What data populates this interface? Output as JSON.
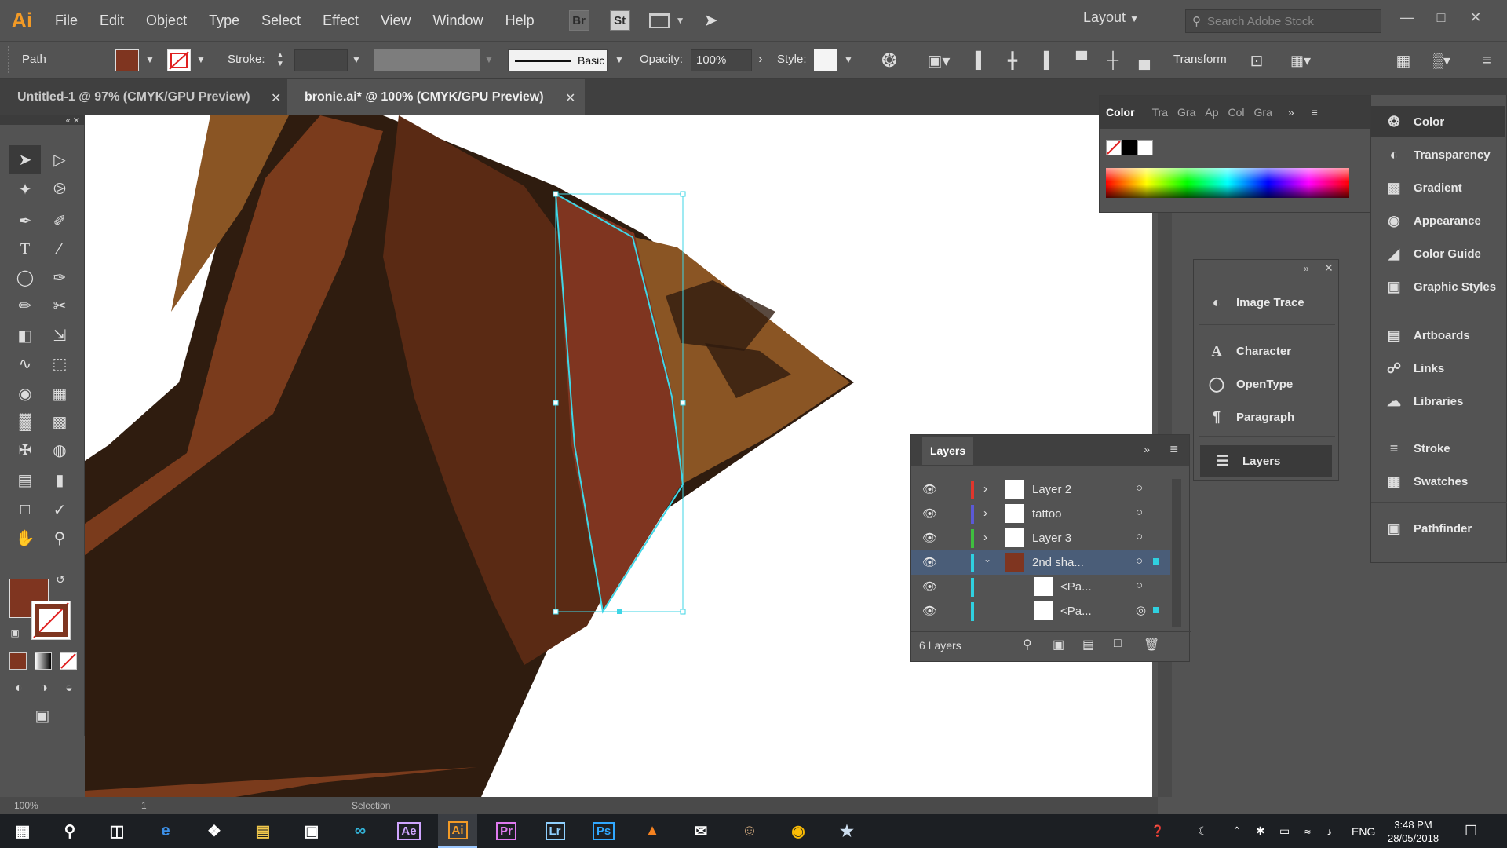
{
  "app": {
    "logo": "Ai"
  },
  "menu": [
    "File",
    "Edit",
    "Object",
    "Type",
    "Select",
    "Effect",
    "View",
    "Window",
    "Help"
  ],
  "bridge_btns": [
    "Br",
    "St"
  ],
  "workspace": "Layout",
  "search": {
    "placeholder": "Search Adobe Stock"
  },
  "control": {
    "selection_label": "Path",
    "stroke_label": "Stroke:",
    "brush_label": "Basic",
    "opacity_label": "Opacity:",
    "opacity_value": "100%",
    "style_label": "Style:",
    "transform_label": "Transform",
    "fill_color": "#7f3520"
  },
  "tabs": [
    {
      "label": "Untitled-1 @ 97% (CMYK/GPU Preview)",
      "active": false
    },
    {
      "label": "bronie.ai* @ 100% (CMYK/GPU Preview)",
      "active": true
    }
  ],
  "color_panel": {
    "tabs": [
      "Color",
      "Tra",
      "Gra",
      "Ap",
      "Col",
      "Gra"
    ]
  },
  "mini_panel": {
    "items": [
      "Image Trace",
      "Character",
      "OpenType",
      "Paragraph",
      "Layers"
    ]
  },
  "layers_panel": {
    "title": "Layers",
    "count": "6 Layers",
    "rows": [
      {
        "name": "Layer 2",
        "color": "#e0362c"
      },
      {
        "name": "tattoo",
        "color": "#5b59d6"
      },
      {
        "name": "Layer 3",
        "color": "#3fbf3f"
      },
      {
        "name": "2nd sha...",
        "color": "#2fd0e0"
      },
      {
        "name": "<Pa...",
        "color": "#2fd0e0"
      },
      {
        "name": "<Pa...",
        "color": "#2fd0e0"
      }
    ]
  },
  "dock": {
    "items": [
      "Color",
      "Transparency",
      "Gradient",
      "Appearance",
      "Color Guide",
      "Graphic Styles",
      "Artboards",
      "Links",
      "Libraries",
      "Stroke",
      "Swatches",
      "Pathfinder"
    ]
  },
  "status": {
    "zoom": "100%",
    "page": "1",
    "tool": "Selection"
  },
  "taskbar": {
    "apps": [
      "Ae",
      "Ai",
      "Pr",
      "Lr",
      "Ps"
    ],
    "lang": "ENG",
    "time": "3:48 PM",
    "date": "28/05/2018"
  },
  "colors": {
    "accent": "#f29a26",
    "selection": "#3fd6e6",
    "brown_dark": "#3d2211",
    "brown_mid": "#7a3b1c",
    "brown_light": "#8a5524"
  }
}
